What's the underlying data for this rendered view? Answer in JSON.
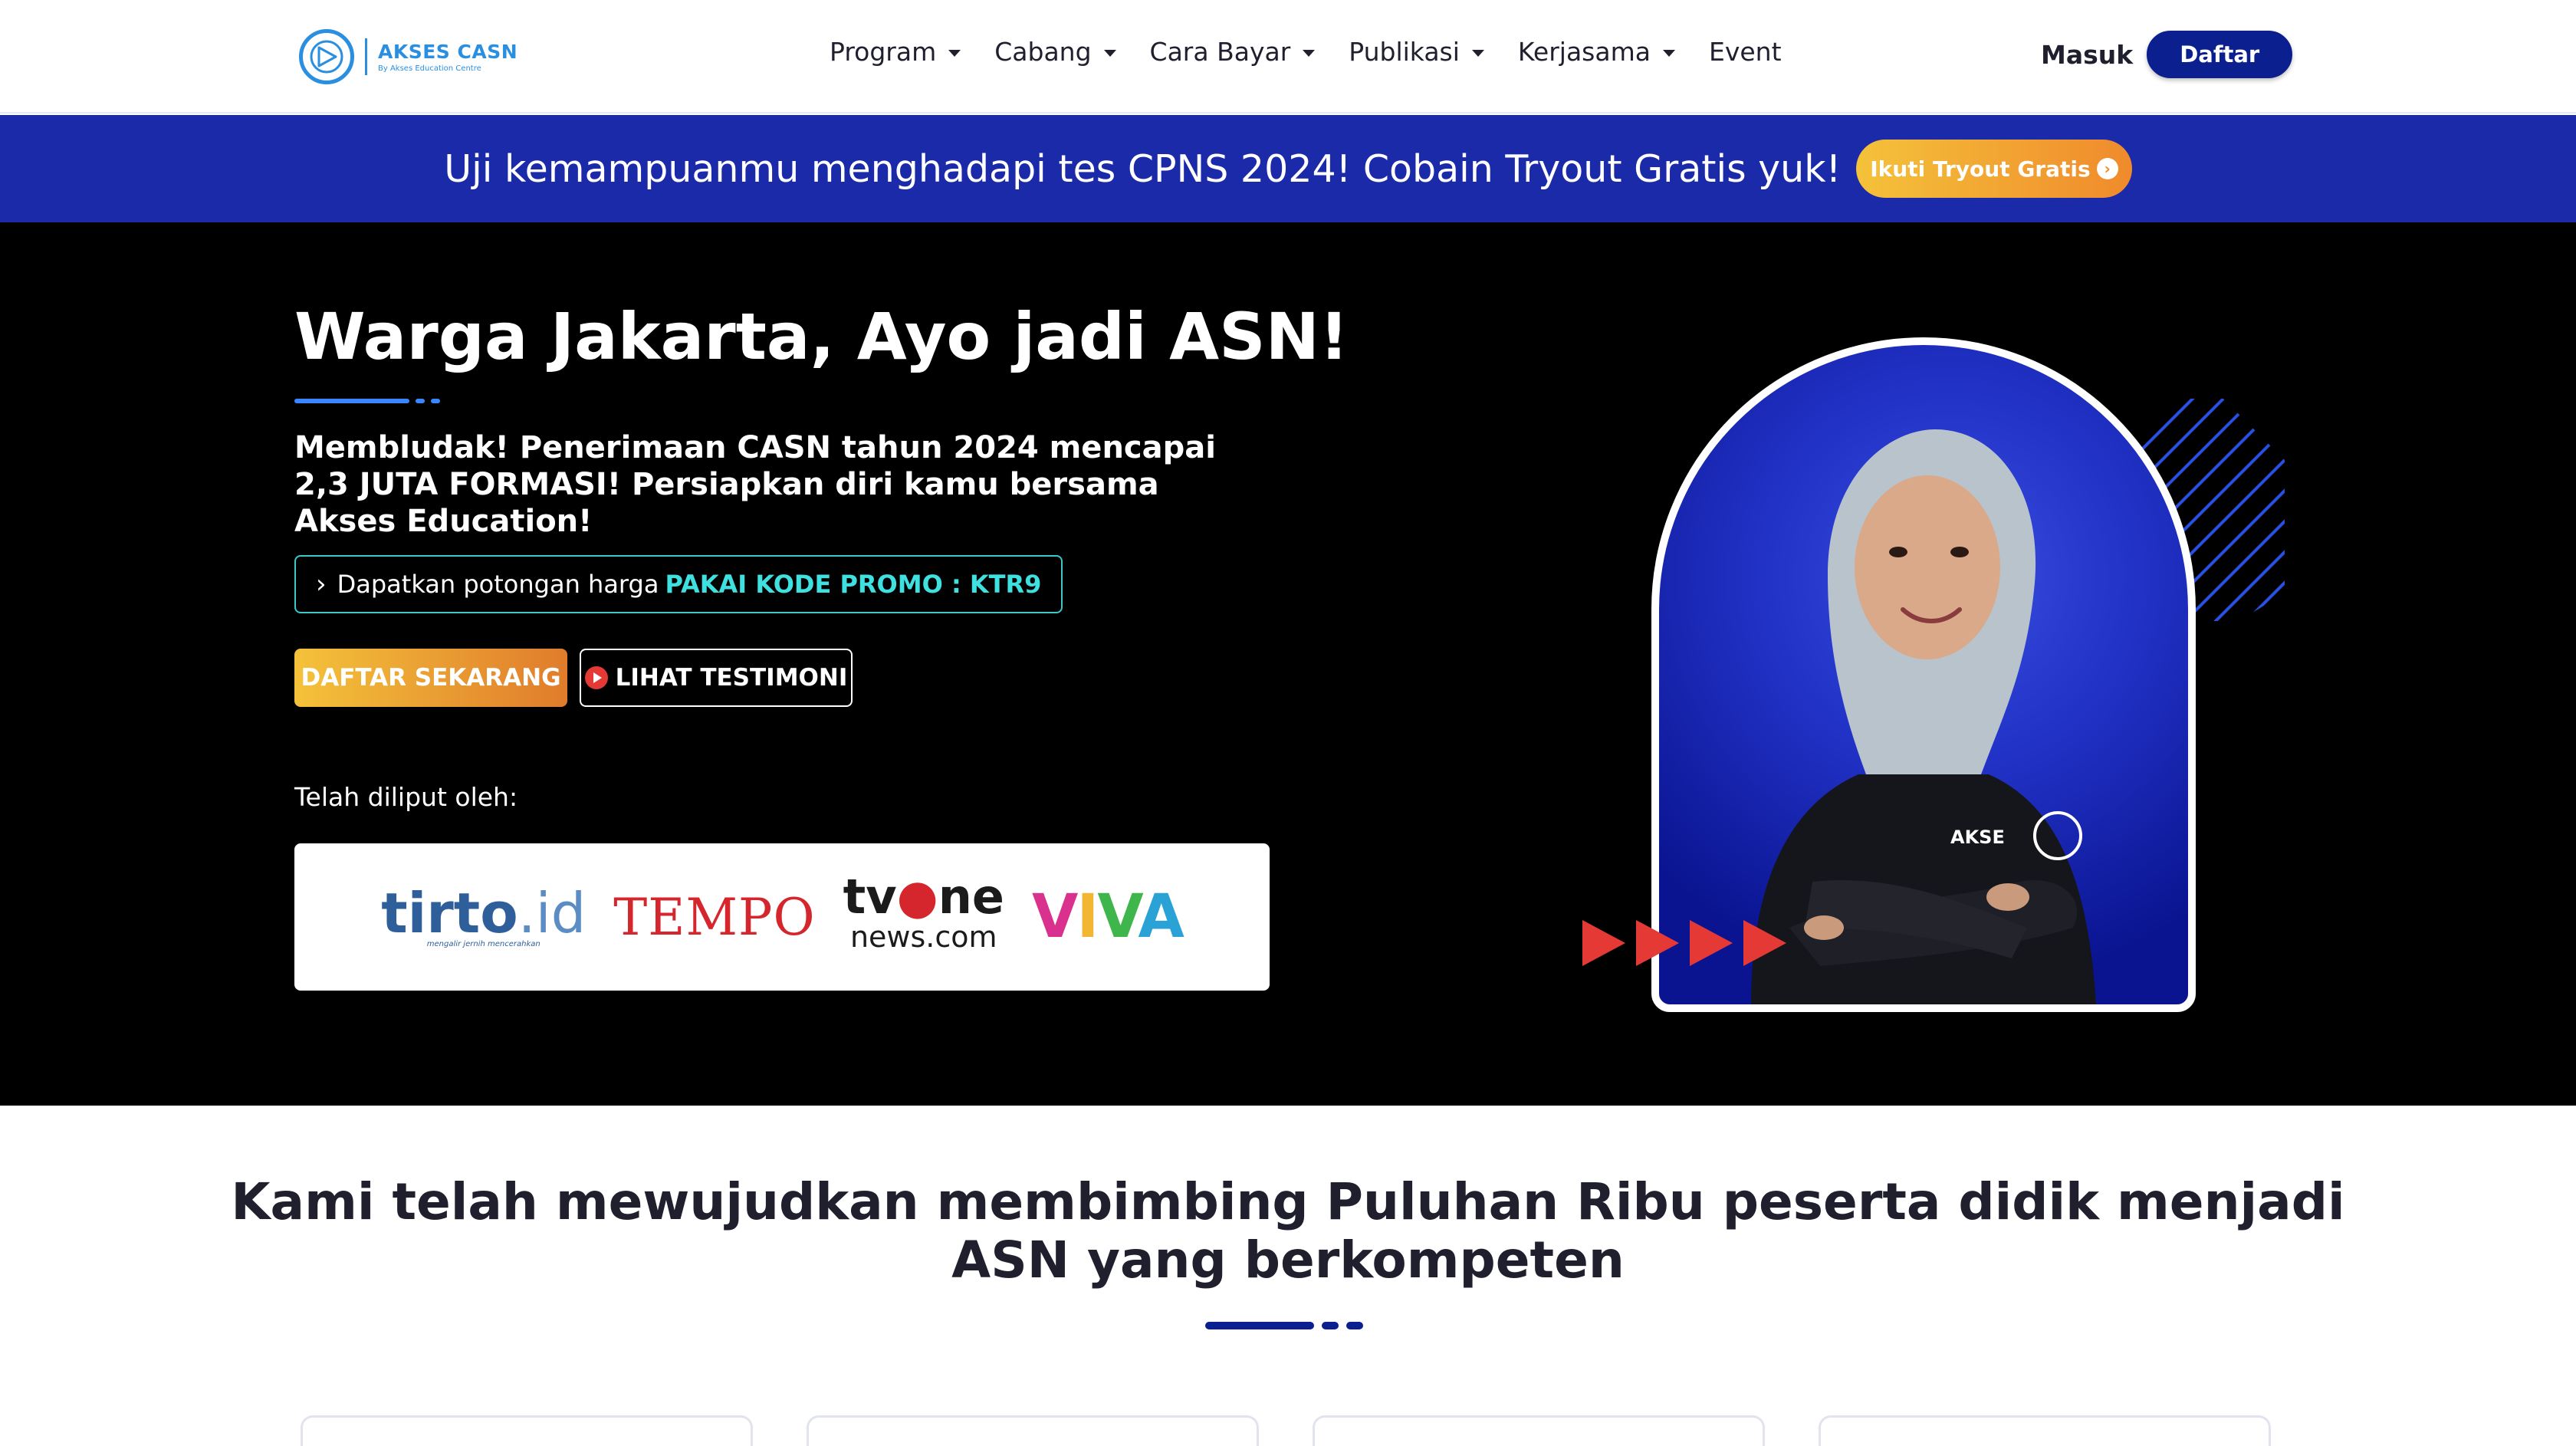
{
  "brand": {
    "name": "AKSES CASN",
    "tagline": "By Akses Education Centre",
    "mark": "AKSES CASN",
    "accent": "#2a8fe0",
    "primary": "#0b1f8f"
  },
  "nav": {
    "items": [
      {
        "label": "Program",
        "dropdown": true
      },
      {
        "label": "Cabang",
        "dropdown": true
      },
      {
        "label": "Cara Bayar",
        "dropdown": true
      },
      {
        "label": "Publikasi",
        "dropdown": true
      },
      {
        "label": "Kerjasama",
        "dropdown": true
      },
      {
        "label": "Event",
        "dropdown": false
      }
    ],
    "login": "Masuk",
    "register": "Daftar"
  },
  "banner": {
    "text": "Uji kemampuanmu menghadapi tes CPNS 2024! Cobain Tryout Gratis yuk!",
    "button": "Ikuti Tryout Gratis",
    "button_icon": "arrow-right-circle-icon",
    "bg_color": "#1a2aa8"
  },
  "hero": {
    "title": "Warga Jakarta, Ayo jadi ASN!",
    "description": "Membludak! Penerimaan CASN tahun 2024 mencapai 2,3 JUTA FORMASI! Persiapkan diri kamu bersama Akses Education!",
    "promo_prefix": "Dapatkan potongan harga",
    "promo_code": "PAKAI KODE PROMO : KTR9",
    "cta_primary": "DAFTAR SEKARANG",
    "cta_secondary": "LIHAT TESTIMONI",
    "cta_secondary_icon": "play-circle-icon",
    "covered_label": "Telah diliput oleh:",
    "media": {
      "tirto": "tirto",
      "tirto_id": ".id",
      "tirto_sub": "mengalir jernih mencerahkan",
      "tempo": "TEMPO",
      "tvone_top_a": "tv",
      "tvone_top_b": "ne",
      "tvone_bottom": "news.com",
      "viva_v1": "V",
      "viva_i": "I",
      "viva_v2": "V",
      "viva_a": "A"
    }
  },
  "stats": {
    "title_line1": "Kami telah mewujudkan membimbing Puluhan Ribu peserta didik menjadi",
    "title_line2": "ASN yang berkompeten"
  }
}
